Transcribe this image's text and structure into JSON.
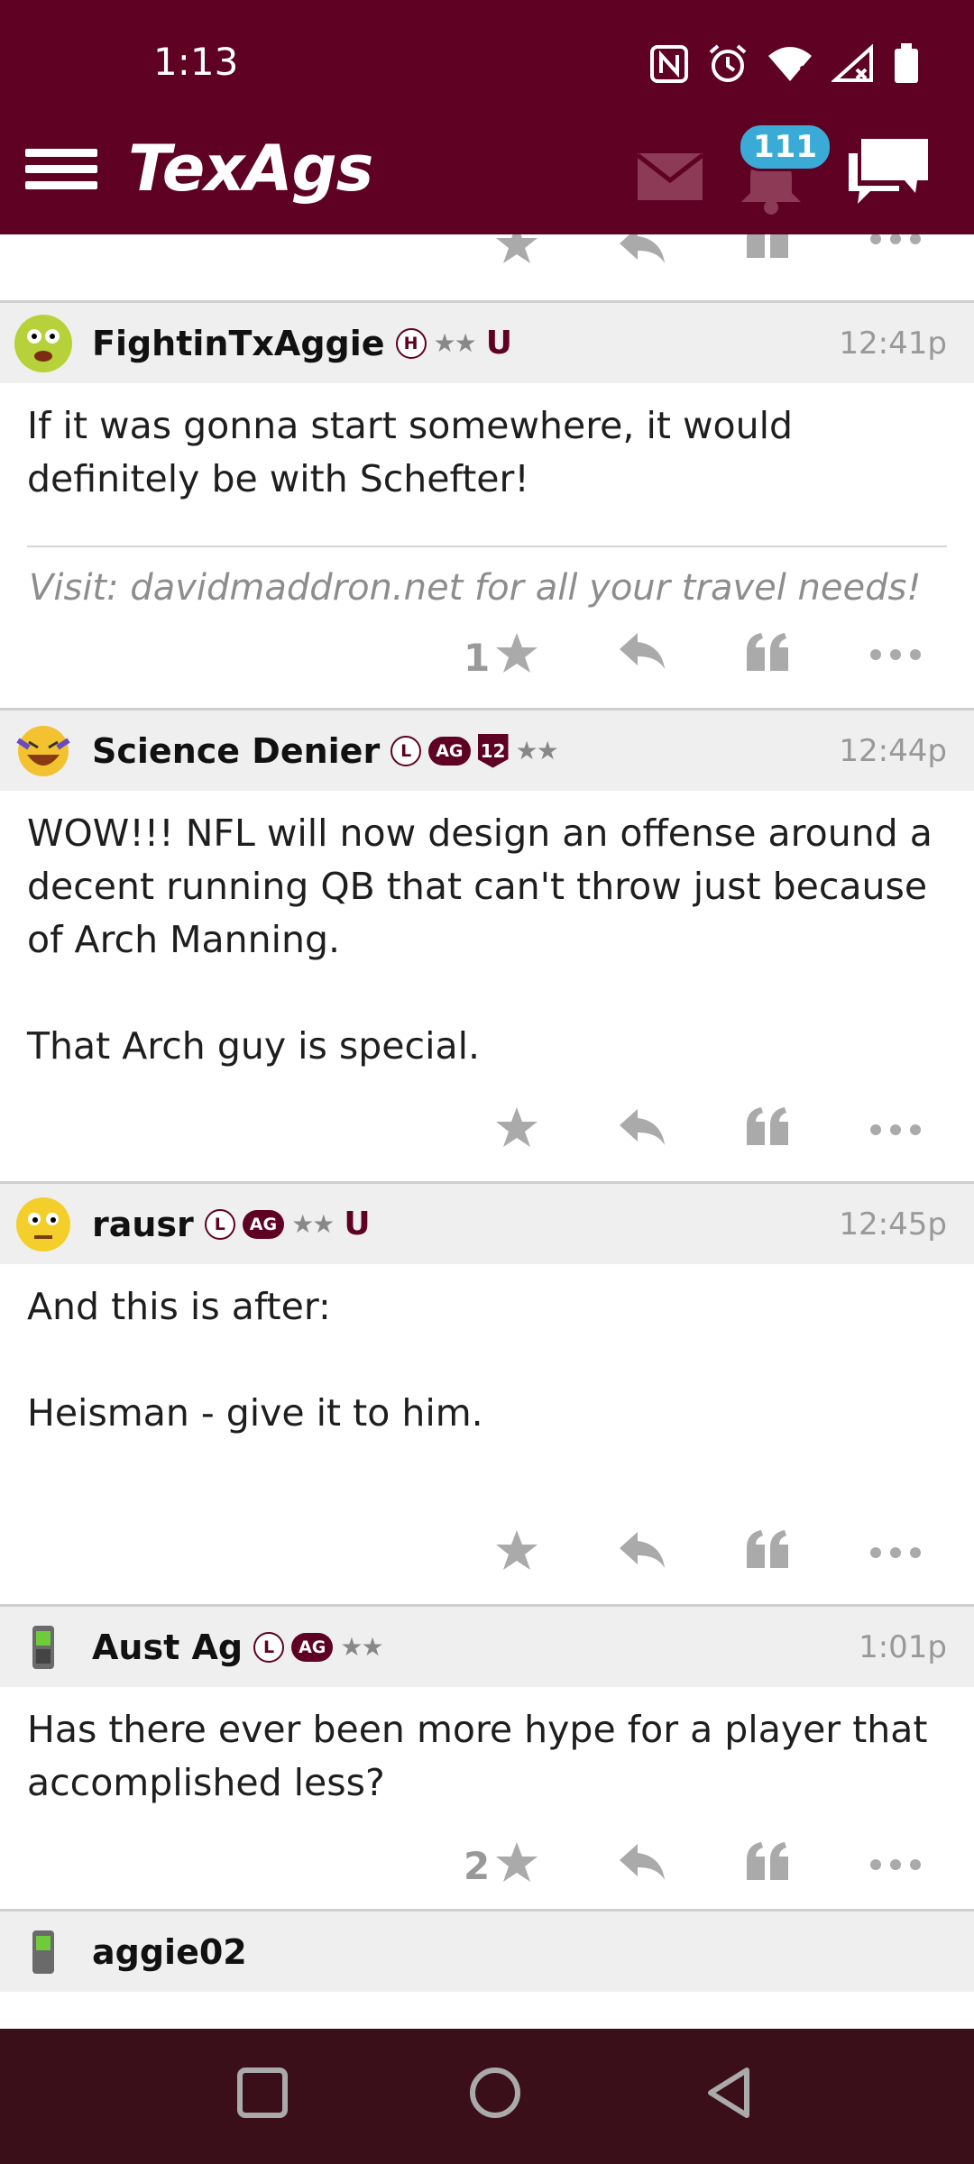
{
  "status": {
    "time": "1:13"
  },
  "app": {
    "logo": "TexAgs",
    "notification_count": "111"
  },
  "posts": [
    {
      "username": "FightinTxAggie",
      "badges": [
        "H"
      ],
      "stars": "★★",
      "has_u": true,
      "time": "12:41p",
      "body": [
        "If it was gonna start somewhere, it would definitely be with Schefter!"
      ],
      "signature": "Visit: davidmaddron.net for all your travel needs!",
      "star_count": "1"
    },
    {
      "username": "Science Denier",
      "time": "12:44p",
      "body": [
        "WOW!!! NFL will now design an offense around a decent running QB that can't throw just because of Arch Manning.",
        "",
        "That Arch guy is special."
      ],
      "star_count": ""
    },
    {
      "username": "rausr",
      "time": "12:45p",
      "body": [
        "And this is after:",
        "",
        "Heisman - give it to him."
      ],
      "star_count": ""
    },
    {
      "username": "Aust Ag",
      "time": "1:01p",
      "body": [
        "Has there ever been more hype for a player that accomplished less?"
      ],
      "star_count": "2"
    }
  ],
  "badge_labels": {
    "h": "H",
    "l": "L",
    "ag": "AG",
    "twelve": "12",
    "stars": "★★",
    "u": "U"
  },
  "next_user_partial": "aggie02"
}
